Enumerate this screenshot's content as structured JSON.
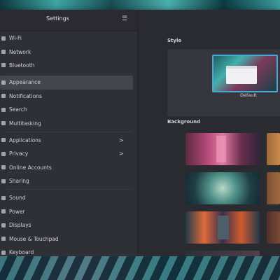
{
  "window": {
    "title": "Settings"
  },
  "sidebar": {
    "menu_icon": "hamburger-menu-icon",
    "groups": [
      {
        "items": [
          {
            "label": "Wi-Fi",
            "icon": "wifi-icon"
          },
          {
            "label": "Network",
            "icon": "network-icon"
          },
          {
            "label": "Bluetooth",
            "icon": "bluetooth-icon"
          }
        ]
      },
      {
        "items": [
          {
            "label": "Appearance",
            "icon": "appearance-icon",
            "selected": true
          },
          {
            "label": "Notifications",
            "icon": "bell-icon"
          },
          {
            "label": "Search",
            "icon": "search-icon"
          },
          {
            "label": "Multitasking",
            "icon": "multitasking-icon"
          }
        ]
      },
      {
        "items": [
          {
            "label": "Applications",
            "icon": "apps-icon",
            "chevron": ">"
          },
          {
            "label": "Privacy",
            "icon": "privacy-icon",
            "chevron": ">"
          },
          {
            "label": "Online Accounts",
            "icon": "accounts-icon"
          },
          {
            "label": "Sharing",
            "icon": "sharing-icon"
          }
        ]
      },
      {
        "items": [
          {
            "label": "Sound",
            "icon": "sound-icon"
          },
          {
            "label": "Power",
            "icon": "power-icon"
          },
          {
            "label": "Displays",
            "icon": "display-icon"
          },
          {
            "label": "Mouse & Touchpad",
            "icon": "mouse-icon"
          },
          {
            "label": "Keyboard",
            "icon": "keyboard-icon"
          }
        ]
      }
    ]
  },
  "content": {
    "style_heading": "Style",
    "style_option": "Default",
    "background_heading": "Background",
    "backgrounds": [
      {
        "name": "pink-forest"
      },
      {
        "name": "orange-partial"
      },
      {
        "name": "teal-wave"
      },
      {
        "name": "brown-partial"
      },
      {
        "name": "orange-city"
      },
      {
        "name": "rust-partial"
      },
      {
        "name": "dark-partial"
      }
    ]
  },
  "colors": {
    "accent": "#4aa7d8",
    "sidebar_bg": "#2f2f36",
    "content_bg": "#2a2a31",
    "selected_bg": "#45454d"
  }
}
